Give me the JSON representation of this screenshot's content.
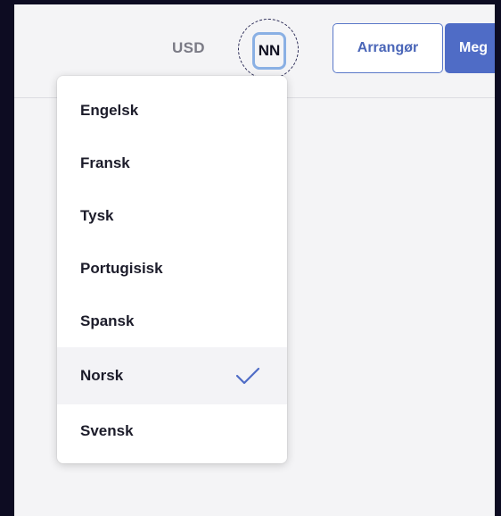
{
  "header": {
    "currency_label": "USD",
    "language_code": "NN",
    "arranger_label": "Arrangør",
    "member_label": "Meg"
  },
  "language_menu": {
    "items": [
      {
        "label": "Engelsk",
        "selected": false
      },
      {
        "label": "Fransk",
        "selected": false
      },
      {
        "label": "Tysk",
        "selected": false
      },
      {
        "label": "Portugisisk",
        "selected": false
      },
      {
        "label": "Spansk",
        "selected": false
      },
      {
        "label": "Norsk",
        "selected": true
      },
      {
        "label": "Svensk",
        "selected": false
      }
    ],
    "selected_icon": "checkmark-icon"
  },
  "colors": {
    "background": "#0d0c22",
    "accent": "#4f6cc6",
    "focus_ring": "#8ab0e4",
    "text_muted": "#7b7b86"
  }
}
